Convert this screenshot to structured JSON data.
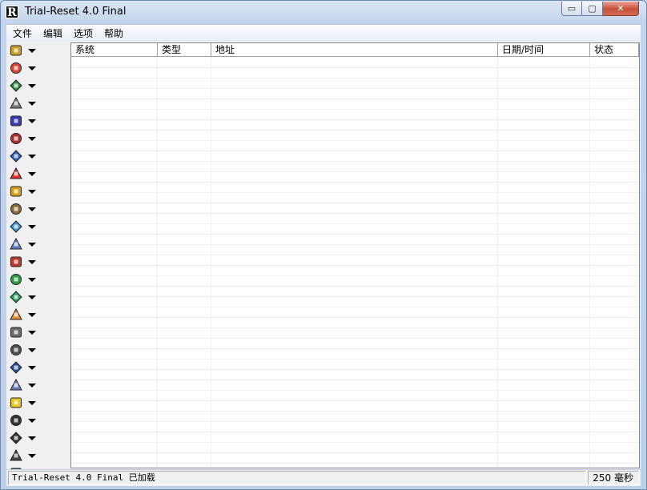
{
  "window": {
    "title": "Trial-Reset 4.0 Final",
    "app_icon_letter": "R",
    "controls": {
      "minimize": "▭",
      "maximize": "▢",
      "close": "✕"
    }
  },
  "menu": [
    {
      "name": "menu-file",
      "label": "文件"
    },
    {
      "name": "menu-edit",
      "label": "编辑"
    },
    {
      "name": "menu-options",
      "label": "选项"
    },
    {
      "name": "menu-help",
      "label": "帮助"
    }
  ],
  "toolbar": {
    "buttons": [
      {
        "icon": "key-folder-icon",
        "color": "#c9a227"
      },
      {
        "icon": "colored-cube-icon",
        "color": "#d64535"
      },
      {
        "icon": "flag-arrow-icon",
        "color": "#2c8a3e"
      },
      {
        "icon": "package-icon",
        "color": "#7a7a7a"
      },
      {
        "icon": "shield-book-icon",
        "color": "#3a3ab0"
      },
      {
        "icon": "network-icon",
        "color": "#b03030"
      },
      {
        "icon": "globe-icon",
        "color": "#2f5fbf"
      },
      {
        "icon": "puzzle-icon",
        "color": "#d9342b"
      },
      {
        "icon": "lock-files-icon",
        "color": "#d4a017"
      },
      {
        "icon": "drive-icon",
        "color": "#8a6a3a"
      },
      {
        "icon": "calendar-icon",
        "color": "#3d8fd1"
      },
      {
        "icon": "chart-icon",
        "color": "#5a7fc0"
      },
      {
        "icon": "gears-icon",
        "color": "#c0392b"
      },
      {
        "icon": "gem-icon",
        "color": "#2e9e45"
      },
      {
        "icon": "circle-m-icon",
        "color": "#1f9e5a"
      },
      {
        "icon": "pencil-icon",
        "color": "#e08a2a"
      },
      {
        "icon": "gear-icon",
        "color": "#6a6a6a"
      },
      {
        "icon": "printer-icon",
        "color": "#505050"
      },
      {
        "icon": "badge-icon",
        "color": "#2a4fa0"
      },
      {
        "icon": "bottle-icon",
        "color": "#6a7fb5"
      },
      {
        "icon": "road-sign-icon",
        "color": "#e8c521"
      },
      {
        "icon": "eagle-icon",
        "color": "#333333"
      },
      {
        "icon": "camera-lock-icon",
        "color": "#303030"
      },
      {
        "icon": "monitor-chart-icon",
        "color": "#444444"
      },
      {
        "icon": "app-icon",
        "color": "#1a7a6a"
      }
    ]
  },
  "list": {
    "columns": [
      {
        "name": "col-system",
        "label": "系统"
      },
      {
        "name": "col-type",
        "label": "类型"
      },
      {
        "name": "col-address",
        "label": "地址"
      },
      {
        "name": "col-datetime",
        "label": "日期/时间"
      },
      {
        "name": "col-status",
        "label": "状态"
      }
    ],
    "rows": []
  },
  "status": {
    "left": "Trial-Reset 4.0 Final 已加载",
    "right": "250 毫秒"
  }
}
